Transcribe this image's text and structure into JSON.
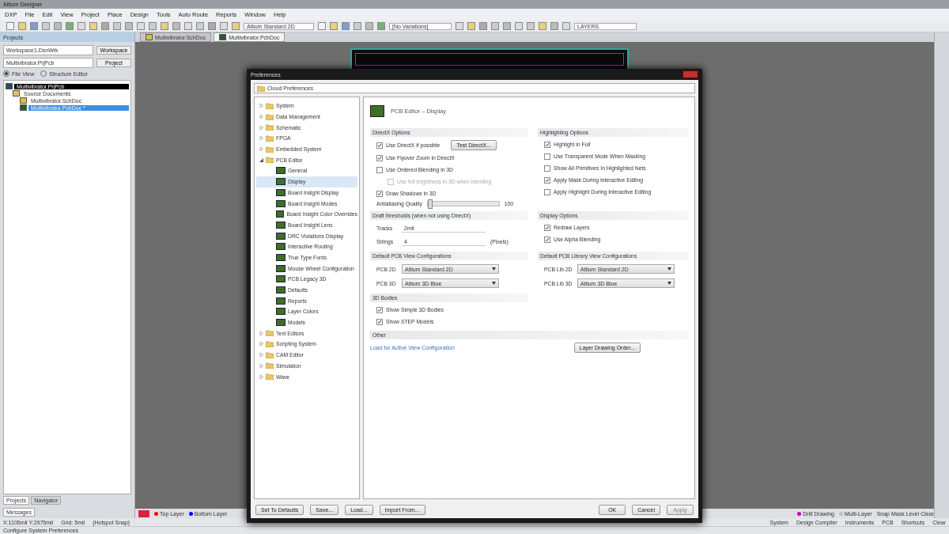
{
  "window": {
    "title": "Altium Designer"
  },
  "menu": [
    "DXP",
    "File",
    "Edit",
    "View",
    "Project",
    "Place",
    "Design",
    "Tools",
    "Auto Route",
    "Reports",
    "Window",
    "Help"
  ],
  "toolbar": {
    "view_config": "Altium Standard 2D",
    "variations": "[No Variations]",
    "layer_set": "LAYERS"
  },
  "projects_panel": {
    "title": "Projects",
    "workspace": "Workspace1.DsnWrk",
    "workspace_button": "Workspace",
    "project": "Multivibrator.PrjPcb",
    "project_button": "Project",
    "views": [
      {
        "label": "File View",
        "selected": true
      },
      {
        "label": "Structure Editor",
        "selected": false
      }
    ],
    "tree": [
      {
        "label": "Multivibrator.PrjPcb",
        "kind": "project",
        "selected": false,
        "children": [
          {
            "label": "Source Documents",
            "kind": "folder",
            "selected": false,
            "children": [
              {
                "label": "Multivibrator.SchDoc",
                "kind": "sch",
                "selected": false
              },
              {
                "label": "Multivibrator.PcbDoc *",
                "kind": "pcb",
                "selected": true
              }
            ]
          }
        ]
      }
    ],
    "tabs": [
      {
        "label": "Projects",
        "selected": true
      },
      {
        "label": "Navigator",
        "selected": false
      }
    ],
    "messages_tab": "Messages"
  },
  "document_tabs": [
    {
      "label": "Multivibrator.SchDoc",
      "kind": "sch",
      "selected": false
    },
    {
      "label": "Multivibrator.PcbDoc",
      "kind": "pcb",
      "selected": true
    }
  ],
  "layer_tabs": [
    {
      "label": "Top Layer",
      "color": "#ff0000"
    },
    {
      "label": "Bottom Layer",
      "color": "#0000ff"
    }
  ],
  "layer_tabs_right": [
    {
      "label": "Drill Drawing",
      "color": "#c800c8"
    },
    {
      "label": "Multi-Layer",
      "color": "#c0c0c0"
    }
  ],
  "right_status": "Snap  Mask Level  Clear",
  "status_bar": {
    "coords": "X:1105mil Y:2975mil",
    "grid": "Grid: 5mil",
    "hotspot": "(Hotspot Snap)",
    "hint": "Configure System Preferences",
    "panels": [
      "System",
      "Design Compiler",
      "Instruments",
      "PCB",
      "Shortcuts",
      "Clear"
    ]
  },
  "dialog": {
    "title": "Preferences",
    "search": "Cloud Preferences",
    "tree": [
      {
        "label": "System",
        "kind": "folder",
        "expanded": false,
        "selected": false
      },
      {
        "label": "Data Management",
        "kind": "folder",
        "expanded": false,
        "selected": false
      },
      {
        "label": "Schematic",
        "kind": "folder",
        "expanded": false,
        "selected": false
      },
      {
        "label": "FPGA",
        "kind": "folder",
        "expanded": false,
        "selected": false
      },
      {
        "label": "Embedded System",
        "kind": "folder",
        "expanded": false,
        "selected": false
      },
      {
        "label": "PCB Editor",
        "kind": "folder",
        "expanded": true,
        "selected": false,
        "children": [
          {
            "label": "General",
            "kind": "page",
            "selected": false
          },
          {
            "label": "Display",
            "kind": "page",
            "selected": true
          },
          {
            "label": "Board Insight Display",
            "kind": "page",
            "selected": false
          },
          {
            "label": "Board Insight Modes",
            "kind": "page",
            "selected": false
          },
          {
            "label": "Board Insight Color Overrides",
            "kind": "page",
            "selected": false
          },
          {
            "label": "Board Insight Lens",
            "kind": "page",
            "selected": false
          },
          {
            "label": "DRC Violations Display",
            "kind": "page",
            "selected": false
          },
          {
            "label": "Interactive Routing",
            "kind": "page",
            "selected": false
          },
          {
            "label": "True Type Fonts",
            "kind": "page",
            "selected": false
          },
          {
            "label": "Mouse Wheel Configuration",
            "kind": "page",
            "selected": false
          },
          {
            "label": "PCB Legacy 3D",
            "kind": "page",
            "selected": false
          },
          {
            "label": "Defaults",
            "kind": "page",
            "selected": false
          },
          {
            "label": "Reports",
            "kind": "page",
            "selected": false
          },
          {
            "label": "Layer Colors",
            "kind": "page",
            "selected": false
          },
          {
            "label": "Models",
            "kind": "page",
            "selected": false
          }
        ]
      },
      {
        "label": "Text Editors",
        "kind": "folder",
        "expanded": false,
        "selected": false
      },
      {
        "label": "Scripting System",
        "kind": "folder",
        "expanded": false,
        "selected": false
      },
      {
        "label": "CAM Editor",
        "kind": "folder",
        "expanded": false,
        "selected": false
      },
      {
        "label": "Simulation",
        "kind": "folder",
        "expanded": false,
        "selected": false
      },
      {
        "label": "Wave",
        "kind": "folder",
        "expanded": false,
        "selected": false
      }
    ],
    "page_title": "PCB Editor – Display",
    "directx": {
      "title": "DirectX Options",
      "test_button": "Test DirectX...",
      "options": [
        {
          "label": "Use DirectX if possible",
          "checked": true,
          "disabled": false
        },
        {
          "label": "Use Flyover Zoom in DirectX",
          "checked": true,
          "disabled": false
        },
        {
          "label": "Use Ordered Blending in 3D",
          "checked": false,
          "disabled": false,
          "children": [
            {
              "label": "Use full brightness in 3D when blending",
              "checked": false,
              "disabled": true
            }
          ]
        },
        {
          "label": "Draw Shadows in 3D",
          "checked": true,
          "disabled": false
        }
      ],
      "antialiasing": {
        "label": "Antialiasing Quality",
        "level": 0.02,
        "reading": "100"
      }
    },
    "highlighting": {
      "title": "Highlighting Options",
      "options": [
        {
          "label": "Highlight in Full",
          "checked": true
        },
        {
          "label": "Use Transparent Mode When Masking",
          "checked": false
        },
        {
          "label": "Show All Primitives In Highlighted Nets",
          "checked": false
        },
        {
          "label": "Apply Mask During Interactive Editing",
          "checked": true
        },
        {
          "label": "Apply Highlight During Interactive Editing",
          "checked": false
        }
      ]
    },
    "draft": {
      "title": "Draft thresholds (when not using DirectX)",
      "fields": [
        {
          "label": "Tracks",
          "value": "2mil"
        },
        {
          "label": "Strings",
          "value": "4",
          "unit": "(Pixels)"
        }
      ]
    },
    "display": {
      "title": "Display Options",
      "options": [
        {
          "label": "Redraw Layers",
          "checked": true
        },
        {
          "label": "Use Alpha Blending",
          "checked": true
        }
      ]
    },
    "pcb_views": {
      "title": "Default PCB View Configurations",
      "rows": [
        {
          "label": "PCB 2D",
          "value": "Altium Standard 2D"
        },
        {
          "label": "PCB 3D",
          "value": "Altium 3D Blue"
        }
      ]
    },
    "lib_views": {
      "title": "Default PCB Library View Configurations",
      "rows": [
        {
          "label": "PCB Lib 2D",
          "value": "Altium Standard 2D"
        },
        {
          "label": "PCB Lib 3D",
          "value": "Altium 3D Blue"
        }
      ]
    },
    "bodies": {
      "title": "3D Bodies",
      "options": [
        {
          "label": "Show Simple 3D Bodies",
          "checked": true
        },
        {
          "label": "Show STEP Models",
          "checked": true
        }
      ]
    },
    "other": {
      "title": "Other",
      "link": "Load for Active View Configuration",
      "button": "Layer Drawing Order..."
    },
    "footer_left": [
      "Set To Defaults",
      "Save...",
      "Load...",
      "Import From..."
    ],
    "footer_right": [
      {
        "label": "OK",
        "disabled": false
      },
      {
        "label": "Cancel",
        "disabled": false
      },
      {
        "label": "Apply",
        "disabled": true
      }
    ]
  }
}
